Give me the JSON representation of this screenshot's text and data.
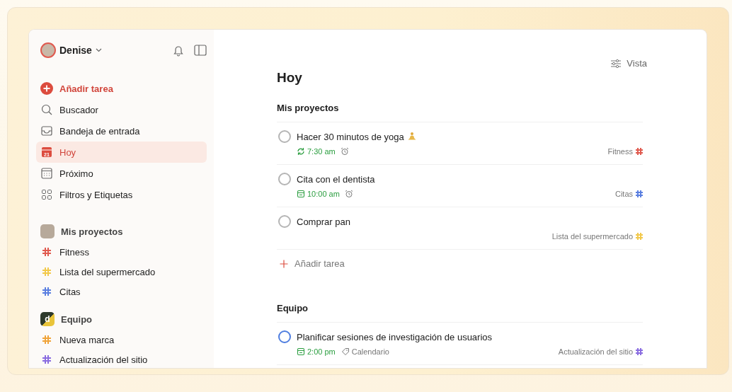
{
  "user": {
    "name": "Denise"
  },
  "nav": [
    {
      "label": "Añadir tarea",
      "kind": "add",
      "selected": false
    },
    {
      "label": "Buscador",
      "kind": "search",
      "selected": false
    },
    {
      "label": "Bandeja de entrada",
      "kind": "inbox",
      "selected": false
    },
    {
      "label": "Hoy",
      "kind": "today",
      "badge": "21",
      "selected": true
    },
    {
      "label": "Próximo",
      "kind": "upcoming",
      "selected": false
    },
    {
      "label": "Filtros y Etiquetas",
      "kind": "filters",
      "selected": false
    }
  ],
  "workspaces": [
    {
      "name": "Mis proyectos",
      "kind": "personal",
      "projects": [
        {
          "name": "Fitness",
          "color": "#e05a4f"
        },
        {
          "name": "Lista del supermercado",
          "color": "#f2c94c"
        },
        {
          "name": "Citas",
          "color": "#5b7fe0"
        }
      ]
    },
    {
      "name": "Equipo",
      "kind": "team",
      "avatar_letter": "d",
      "projects": [
        {
          "name": "Nueva marca",
          "color": "#f0a43a"
        },
        {
          "name": "Actualización del sitio",
          "color": "#8a6de0"
        }
      ]
    }
  ],
  "view_button": "Vista",
  "page_title": "Hoy",
  "sections": [
    {
      "title": "Mis proyectos",
      "add_task": "Añadir tarea",
      "tasks": [
        {
          "title": "Hacer 30 minutos de yoga",
          "emoji": true,
          "due": {
            "kind": "recurring",
            "time": "7:30 am"
          },
          "reminder": true,
          "project": {
            "name": "Fitness",
            "color": "#e05a4f"
          },
          "checkbox": {
            "color": "#b5b5b5"
          }
        },
        {
          "title": "Cita con el dentista",
          "emoji": false,
          "due": {
            "kind": "calendar",
            "time": "10:00 am"
          },
          "reminder": true,
          "project": {
            "name": "Citas",
            "color": "#5b7fe0"
          },
          "checkbox": {
            "color": "#b5b5b5"
          }
        },
        {
          "title": "Comprar pan",
          "emoji": false,
          "reminder": false,
          "project": {
            "name": "Lista del supermercado",
            "color": "#f2c94c"
          },
          "checkbox": {
            "color": "#b5b5b5"
          }
        }
      ]
    },
    {
      "title": "Equipo",
      "tasks": [
        {
          "title": "Planificar sesiones de investigación de usuarios",
          "emoji": false,
          "due": {
            "kind": "calendar",
            "time": "2:00 pm"
          },
          "reminder": false,
          "label": "Calendario",
          "project": {
            "name": "Actualización del sitio",
            "color": "#8a6de0"
          },
          "checkbox": {
            "color": "#4f7ee0"
          }
        }
      ]
    }
  ]
}
